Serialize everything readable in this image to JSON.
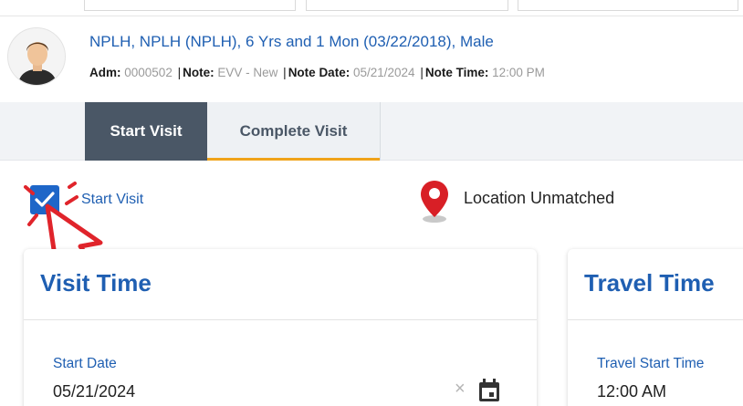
{
  "patient": {
    "name_line": "NPLH, NPLH (NPLH), 6 Yrs and 1 Mon (03/22/2018), Male",
    "meta": [
      {
        "key": "Adm:",
        "value": "0000502"
      },
      {
        "key": "Note:",
        "value": "EVV - New"
      },
      {
        "key": "Note Date:",
        "value": "05/21/2024"
      },
      {
        "key": "Note Time:",
        "value": "12:00 PM"
      }
    ],
    "separator": "|"
  },
  "tabs": [
    {
      "label": "Start Visit",
      "active": true
    },
    {
      "label": "Complete Visit",
      "active": false
    }
  ],
  "start_visit": {
    "checked": true,
    "label": "Start Visit"
  },
  "location": {
    "icon": "map-pin-icon",
    "label": "Location Unmatched"
  },
  "visit_time": {
    "title": "Visit Time",
    "start_date_label": "Start Date",
    "start_date_value": "05/21/2024",
    "clear_symbol": "×"
  },
  "travel_time": {
    "title": "Travel Time",
    "travel_start_label": "Travel Start Time",
    "travel_start_value": "12:00 AM"
  },
  "colors": {
    "accent_blue": "#1f5fb2",
    "checkbox_blue": "#1e66c8",
    "tab_active": "#4a5766",
    "tab_underline": "#f0a31a",
    "pin_red": "#d81f26",
    "annotation_red": "#e0242b"
  }
}
